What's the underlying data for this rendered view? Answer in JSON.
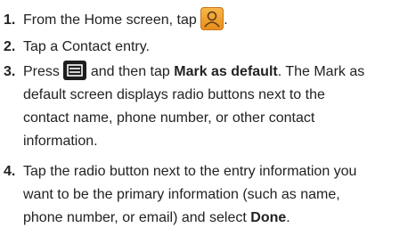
{
  "steps": [
    {
      "number": "1.",
      "before": "From the Home screen, tap",
      "icon": "contacts-icon",
      "after": "."
    },
    {
      "number": "2.",
      "text": "Tap a Contact entry."
    },
    {
      "number": "3.",
      "line1_before": "Press",
      "icon": "menu-key-icon",
      "line1_mid": "and then tap",
      "line1_bold": "Mark as default",
      "line1_after": ". The Mark as",
      "line2": "default screen displays radio buttons next to the",
      "line3": "contact name, phone number, or other contact",
      "line4": "information."
    },
    {
      "number": "4.",
      "line1": "Tap the radio button next to the entry information you",
      "line2": "want to be the primary information (such as name,",
      "line3_before": "phone number, or email) and select",
      "line3_bold": "Done",
      "line3_after": "."
    }
  ]
}
